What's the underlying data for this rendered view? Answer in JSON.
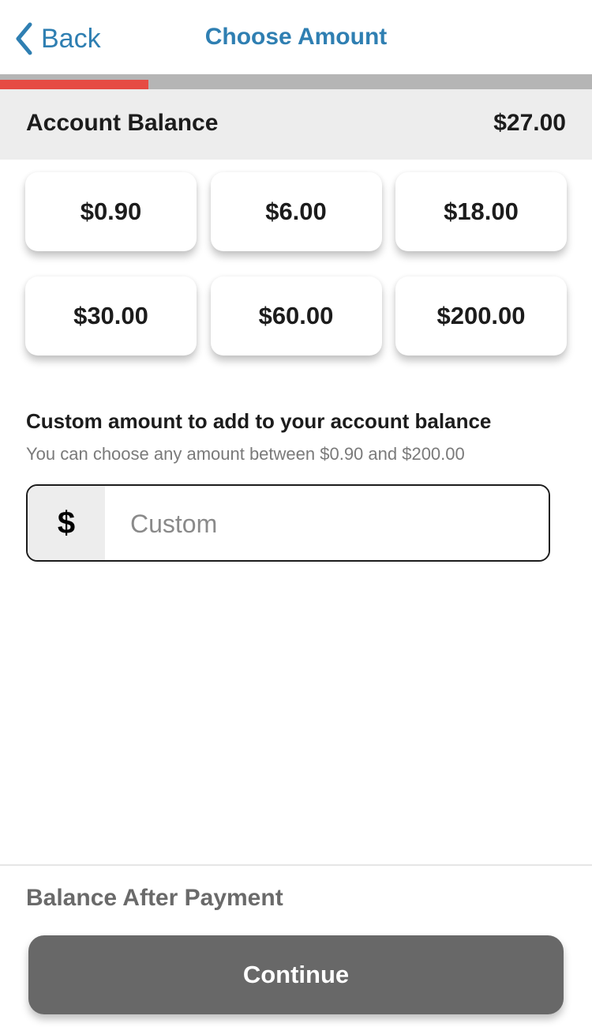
{
  "nav": {
    "back_label": "Back",
    "back_icon": "chevron-left-icon",
    "title": "Choose Amount",
    "accent_color": "#2f7fb2"
  },
  "progress": {
    "fraction": 0.25,
    "fill_color": "#e64b43",
    "track_color": "#b5b5b5"
  },
  "account_balance": {
    "label": "Account Balance",
    "value": "$27.00"
  },
  "amount_options": [
    {
      "label": "$0.90"
    },
    {
      "label": "$6.00"
    },
    {
      "label": "$18.00"
    },
    {
      "label": "$30.00"
    },
    {
      "label": "$60.00"
    },
    {
      "label": "$200.00"
    }
  ],
  "custom": {
    "title": "Custom amount to add to your account balance",
    "subtitle": "You can choose any amount between $0.90 and $200.00",
    "currency_symbol": "$",
    "placeholder": "Custom",
    "value": ""
  },
  "footer": {
    "balance_after_label": "Balance After Payment",
    "continue_label": "Continue",
    "continue_color": "#686868"
  }
}
